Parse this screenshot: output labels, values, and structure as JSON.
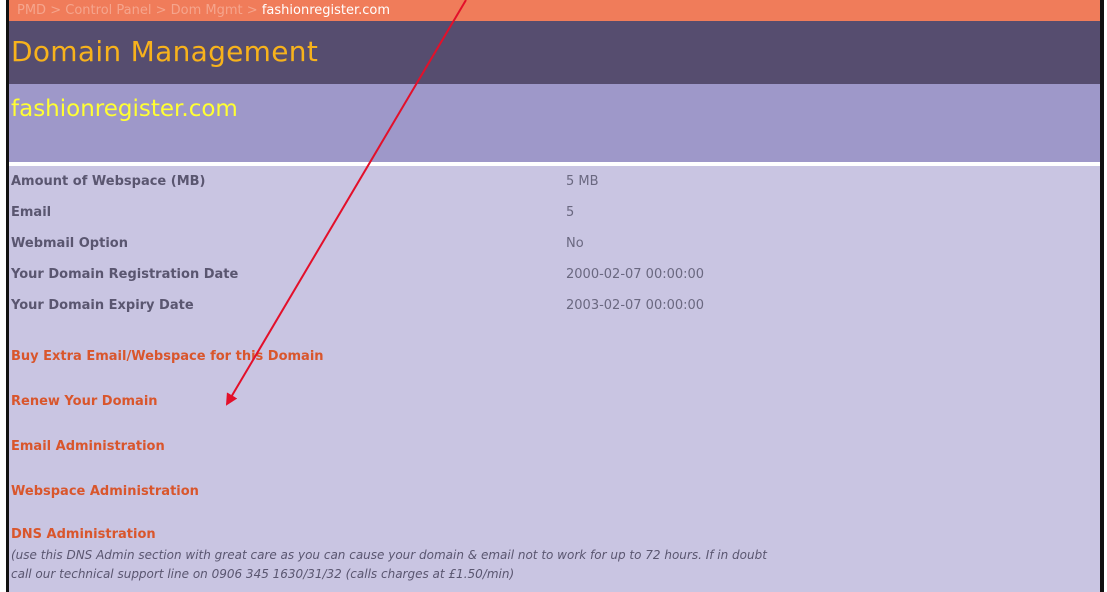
{
  "breadcrumb": {
    "items": [
      "PMD",
      "Control Panel",
      "Dom Mgmt"
    ],
    "separator": ">",
    "current": "fashionregister.com"
  },
  "header": {
    "title": "Domain Management"
  },
  "domain": {
    "name": "fashionregister.com"
  },
  "details": [
    {
      "label": "Amount of Webspace (MB)",
      "value": "5 MB"
    },
    {
      "label": "Email",
      "value": "5"
    },
    {
      "label": "Webmail Option",
      "value": "No"
    },
    {
      "label": "Your Domain Registration Date",
      "value": "2000-02-07 00:00:00"
    },
    {
      "label": "Your Domain Expiry Date",
      "value": "2003-02-07 00:00:00"
    }
  ],
  "links": {
    "buy_extra": "Buy Extra Email/Webspace for this Domain",
    "renew": "Renew Your Domain",
    "email_admin": "Email Administration",
    "webspace_admin": "Webspace Administration",
    "dns_admin": "DNS Administration"
  },
  "dns_note": {
    "line1": "(use this DNS Admin section with great care as you can cause your domain & email not to work for up to 72 hours. If in doubt",
    "line2": "call our technical support line on 0906 345 1630/31/32 (calls charges at £1.50/min)"
  },
  "colors": {
    "breadcrumb_bg": "#f07c5a",
    "header_bg": "#564d6f",
    "title_text": "#f7b21c",
    "subheader_bg": "#9e98c9",
    "domain_text": "#ffff33",
    "content_bg": "#c9c5e2",
    "link_text": "#d9562c",
    "annotation_arrow": "#e3102a"
  }
}
